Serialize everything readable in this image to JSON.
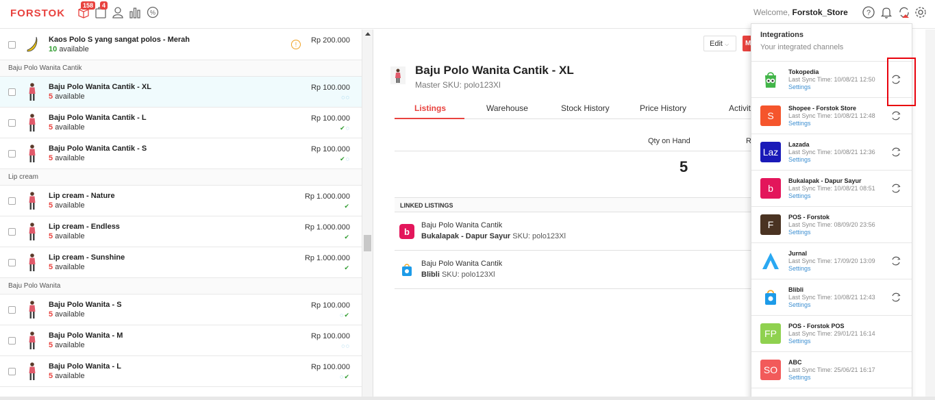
{
  "header": {
    "logo": "FORSTOK",
    "badge_orders": "158",
    "badge_packages": "4",
    "welcome_prefix": "Welcome,",
    "store_name": "Forstok_Store"
  },
  "products": {
    "top_item": {
      "name": "Kaos Polo S yang sangat polos - Merah",
      "qty": "10",
      "avail": "available",
      "price": "Rp 200.000"
    },
    "groups": [
      {
        "title": "Baju Polo Wanita Cantik",
        "items": [
          {
            "name": "Baju Polo Wanita Cantik - XL",
            "qty": "5",
            "avail": "available",
            "price": "Rp 100.000",
            "marks": "◌◌"
          },
          {
            "name": "Baju Polo Wanita Cantik - L",
            "qty": "5",
            "avail": "available",
            "price": "Rp 100.000",
            "marks": "✔◌"
          },
          {
            "name": "Baju Polo Wanita Cantik - S",
            "qty": "5",
            "avail": "available",
            "price": "Rp 100.000",
            "marks": "✔◌"
          }
        ]
      },
      {
        "title": "Lip cream",
        "items": [
          {
            "name": "Lip cream - Nature",
            "qty": "5",
            "avail": "available",
            "price": "Rp 1.000.000",
            "marks": "✔"
          },
          {
            "name": "Lip cream - Endless",
            "qty": "5",
            "avail": "available",
            "price": "Rp 1.000.000",
            "marks": "✔"
          },
          {
            "name": "Lip cream - Sunshine",
            "qty": "5",
            "avail": "available",
            "price": "Rp 1.000.000",
            "marks": "✔"
          }
        ]
      },
      {
        "title": "Baju Polo Wanita",
        "items": [
          {
            "name": "Baju Polo Wanita - S",
            "qty": "5",
            "avail": "available",
            "price": "Rp 100.000",
            "marks": "◌✔"
          },
          {
            "name": "Baju Polo Wanita - M",
            "qty": "5",
            "avail": "available",
            "price": "Rp 100.000",
            "marks": "◌◌"
          },
          {
            "name": "Baju Polo Wanita - L",
            "qty": "5",
            "avail": "available",
            "price": "Rp 100.000",
            "marks": "◌✔"
          }
        ]
      }
    ]
  },
  "detail": {
    "edit_label": "Edit",
    "red_label": "M",
    "title": "Baju Polo Wanita Cantik - XL",
    "sku": "Master SKU: polo123Xl",
    "tabs": [
      "Listings",
      "Warehouse",
      "Stock History",
      "Price History",
      "Activit"
    ],
    "qty_label": "Qty on Hand",
    "qty_label2": "R",
    "qty_value": "5",
    "linked_title": "LINKED LISTINGS",
    "linked": [
      {
        "name": "Baju Polo Wanita Cantik",
        "channel": "Bukalapak - Dapur Sayur",
        "sku": "SKU: polo123Xl"
      },
      {
        "name": "Baju Polo Wanita Cantik",
        "channel": "Blibli",
        "sku": "SKU: polo123Xl"
      }
    ]
  },
  "integrations": {
    "title": "Integrations",
    "subtitle": "Your integrated channels",
    "settings_label": "Settings",
    "channels": [
      {
        "name": "Tokopedia",
        "time": "Last Sync Time: 10/08/21 12:50",
        "logo_text": "",
        "color": "#ffffff",
        "sync": true
      },
      {
        "name": "Shopee - Forstok Store",
        "time": "Last Sync Time: 10/08/21 12:48",
        "logo_text": "S",
        "color": "#f5552c",
        "sync": true
      },
      {
        "name": "Lazada",
        "time": "Last Sync Time: 10/08/21 12:36",
        "logo_text": "Laz",
        "color": "#1a1ab8",
        "sync": true
      },
      {
        "name": "Bukalapak - Dapur Sayur",
        "time": "Last Sync Time: 10/08/21 08:51",
        "logo_text": "b",
        "color": "#e3165b",
        "sync": true
      },
      {
        "name": "POS - Forstok",
        "time": "Last Sync Time: 08/09/20 23:56",
        "logo_text": "F",
        "color": "#4a3322",
        "sync": false
      },
      {
        "name": "Jurnal",
        "time": "Last Sync Time: 17/09/20 13:09",
        "logo_text": "",
        "color": "#ffffff",
        "sync": true
      },
      {
        "name": "Blibli",
        "time": "Last Sync Time: 10/08/21 12:43",
        "logo_text": "",
        "color": "#ffffff",
        "sync": true
      },
      {
        "name": "POS - Forstok POS",
        "time": "Last Sync Time: 29/01/21 16:14",
        "logo_text": "FP",
        "color": "#8fd14f",
        "sync": false
      },
      {
        "name": "ABC",
        "time": "Last Sync Time: 25/06/21 16:17",
        "logo_text": "SO",
        "color": "#f25a5a",
        "sync": false
      }
    ]
  }
}
